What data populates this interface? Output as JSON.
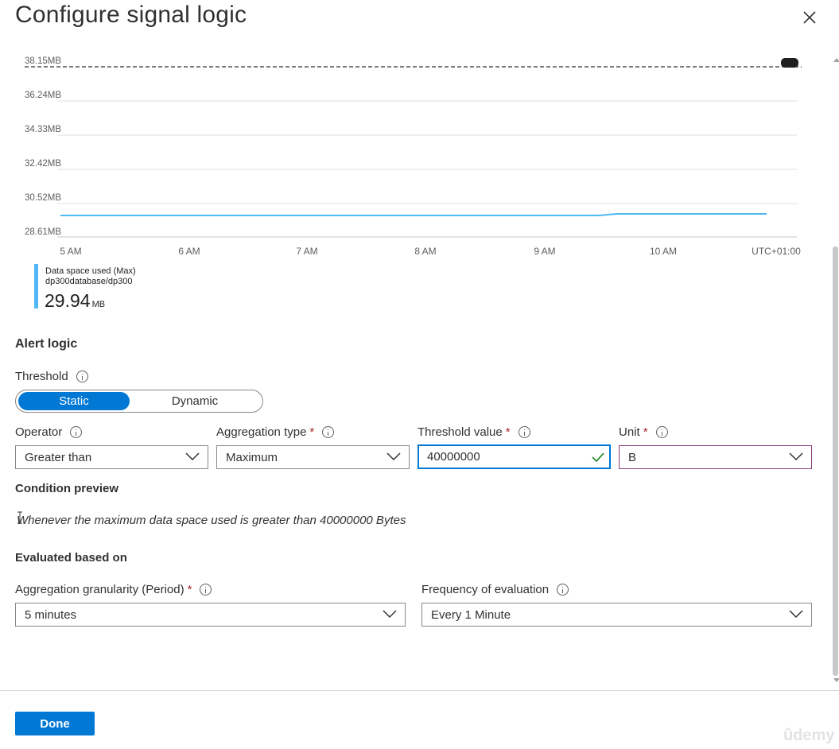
{
  "header": {
    "title": "Configure signal logic",
    "close_icon": "close-icon"
  },
  "chart": {
    "y_ticks": [
      "38.15MB",
      "36.24MB",
      "34.33MB",
      "32.42MB",
      "30.52MB",
      "28.61MB"
    ],
    "x_ticks": [
      "5 AM",
      "6 AM",
      "7 AM",
      "8 AM",
      "9 AM",
      "10 AM",
      "UTC+01:00"
    ],
    "threshold_label": "38.15MB",
    "series_color": "#4fb8f5",
    "legend": {
      "name": "Data space used (Max)",
      "resource": "dp300database/dp300",
      "value": "29.94",
      "unit": "MB"
    }
  },
  "chart_data": {
    "type": "line",
    "xlabel": "",
    "ylabel": "",
    "ylim": [
      "28.61MB",
      "38.15MB"
    ],
    "x": [
      "5 AM",
      "6 AM",
      "7 AM",
      "8 AM",
      "9 AM",
      "10 AM"
    ],
    "series": [
      {
        "name": "Data space used (Max)",
        "unit": "MB",
        "points": [
          {
            "x": "4:58 AM",
            "y": 29.92
          },
          {
            "x": "9:28 AM",
            "y": 29.92
          },
          {
            "x": "9:38 AM",
            "y": 29.94
          },
          {
            "x": "10:52 AM",
            "y": 29.94
          }
        ]
      }
    ],
    "threshold_line": 38.15,
    "grid": true
  },
  "alert_logic": {
    "heading": "Alert logic",
    "threshold_label": "Threshold",
    "threshold_options": [
      "Static",
      "Dynamic"
    ],
    "threshold_selected": "Static",
    "operator": {
      "label": "Operator",
      "value": "Greater than"
    },
    "aggregation_type": {
      "label": "Aggregation type",
      "required": "*",
      "value": "Maximum"
    },
    "threshold_value": {
      "label": "Threshold value",
      "required": "*",
      "value": "40000000"
    },
    "unit": {
      "label": "Unit",
      "required": "*",
      "value": "B"
    }
  },
  "condition_preview": {
    "heading": "Condition preview",
    "text": "Whenever the maximum data space used is greater than 40000000 Bytes"
  },
  "evaluated": {
    "heading": "Evaluated based on",
    "granularity": {
      "label": "Aggregation granularity (Period)",
      "required": "*",
      "value": "5 minutes"
    },
    "frequency": {
      "label": "Frequency of evaluation",
      "value": "Every 1 Minute"
    }
  },
  "footer": {
    "done_label": "Done"
  },
  "watermark": "ûdemy",
  "colors": {
    "accent": "#0078d4",
    "required": "#a4262c",
    "success": "#107c10"
  }
}
